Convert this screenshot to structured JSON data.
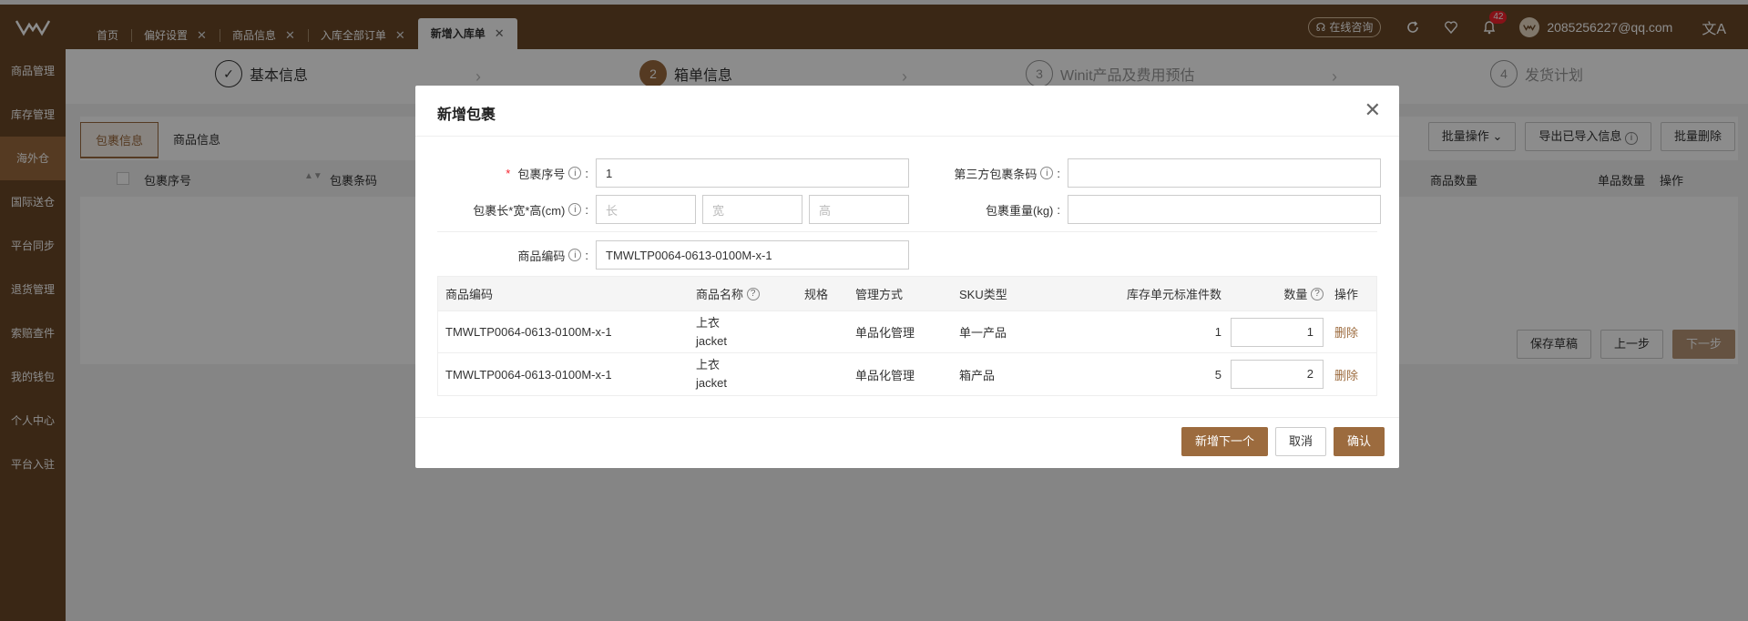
{
  "tabs": [
    {
      "label": "首页",
      "closable": false
    },
    {
      "label": "偏好设置",
      "closable": true
    },
    {
      "label": "商品信息",
      "closable": true
    },
    {
      "label": "入库全部订单",
      "closable": true
    },
    {
      "label": "新增入库单",
      "closable": true,
      "active": true
    }
  ],
  "topbar": {
    "consult": "在线咨询",
    "badge_count": "42",
    "email": "2085256227@qq.com",
    "lang": "文A"
  },
  "sidebar": {
    "items": [
      "商品管理",
      "库存管理",
      "海外仓",
      "国际送仓",
      "平台同步",
      "退货管理",
      "索赔查件",
      "我的钱包",
      "个人中心",
      "平台入驻"
    ],
    "active_index": 2
  },
  "steps": [
    {
      "num": "✓",
      "label": "基本信息"
    },
    {
      "num": "2",
      "label": "箱单信息"
    },
    {
      "num": "3",
      "label": "Winit产品及费用预估"
    },
    {
      "num": "4",
      "label": "发货计划"
    }
  ],
  "page": {
    "inner_tabs": [
      "包裹信息",
      "商品信息"
    ],
    "batch_ops": "批量操作",
    "export": "导出已导入信息",
    "batch_delete": "批量删除",
    "headers": {
      "pkg_no": "包裹序号",
      "pkg_code": "包裹条码",
      "goods_qty": "商品数量",
      "unit_qty": "单品数量",
      "ops": "操作"
    },
    "save_draft": "保存草稿",
    "prev": "上一步",
    "next": "下一步"
  },
  "modal": {
    "title": "新增包裹",
    "pkg_no_label": "包裹序号",
    "pkg_no_value": "1",
    "third_code_label": "第三方包裹条码",
    "third_code_value": "",
    "dims_label": "包裹长*宽*高(cm)",
    "len_ph": "长",
    "wid_ph": "宽",
    "hei_ph": "高",
    "weight_label": "包裹重量(kg)",
    "weight_value": "",
    "sku_label": "商品编码",
    "sku_value": "TMWLTP0064-0613-0100M-x-1",
    "table": {
      "headers": [
        "商品编码",
        "商品名称",
        "规格",
        "管理方式",
        "SKU类型",
        "库存单元标准件数",
        "数量",
        "操作"
      ],
      "rows": [
        {
          "code": "TMWLTP0064-0613-0100M-x-1",
          "name_cn": "上衣",
          "name_en": "jacket",
          "spec": "",
          "mode": "单品化管理",
          "type": "单一产品",
          "std": "1",
          "qty": "1",
          "op": "删除"
        },
        {
          "code": "TMWLTP0064-0613-0100M-x-1",
          "name_cn": "上衣",
          "name_en": "jacket",
          "spec": "",
          "mode": "单品化管理",
          "type": "箱产品",
          "std": "5",
          "qty": "2",
          "op": "删除"
        }
      ]
    },
    "btn_next_add": "新增下一个",
    "btn_cancel": "取消",
    "btn_confirm": "确认"
  },
  "colors": {
    "brand": "#6b4827",
    "accent": "#9c6b3e"
  }
}
